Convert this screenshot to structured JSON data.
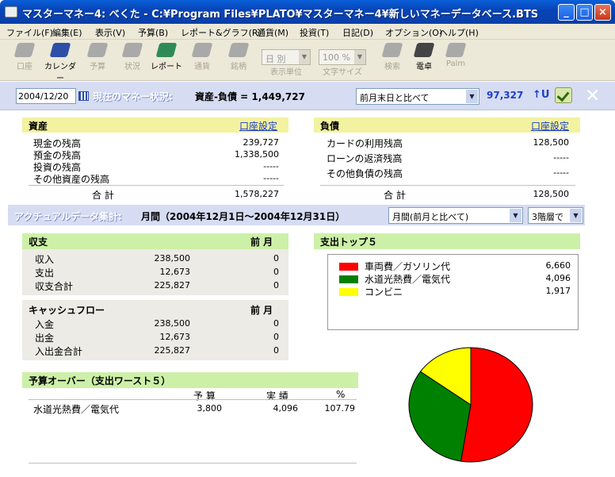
{
  "window": {
    "title": "マスターマネー4: べくた - C:¥Program Files¥PLATO¥マスターマネー4¥新しいマネーデータベース.BTS",
    "min": "_",
    "max": "□",
    "close": "×"
  },
  "menu": [
    "ファイル(F)",
    "編集(E)",
    "表示(V)",
    "予算(B)",
    "レポート&グラフ(R)",
    "通貨(M)",
    "投資(T)",
    "日記(D)",
    "オプション(O)",
    "ヘルプ(H)"
  ],
  "toolbar": {
    "koza": "口座",
    "calendar": "カレンダー",
    "budget": "予算",
    "status": "状況",
    "report": "レポート",
    "currency": "通貨",
    "brand": "銘柄",
    "unit_value": "日 別",
    "unit_label": "表示単位",
    "size_value": "100 %",
    "size_label": "文字サイズ",
    "search": "検索",
    "dentaku": "電卓",
    "palm": "Palm"
  },
  "status": {
    "date": "2004/12/20",
    "title": "現在のマネー状況:",
    "net_label": "資産-負債 =",
    "net_value": "1,449,727",
    "compare": "前月末日と比べて",
    "diff": "97,327",
    "diff_arrow": "↑U",
    "close": "✕"
  },
  "assets": {
    "title": "資産",
    "link": "口座設定",
    "rows": [
      {
        "label": "現金の残高",
        "value": "239,727"
      },
      {
        "label": "預金の残高",
        "value": "1,338,500"
      },
      {
        "label": "投資の残高",
        "value": "-----"
      },
      {
        "label": "その他資産の残高",
        "value": "-----"
      }
    ],
    "total_label": "合 計",
    "total": "1,578,227"
  },
  "liabilities": {
    "title": "負債",
    "link": "口座設定",
    "rows": [
      {
        "label": "カードの利用残高",
        "value": "128,500"
      },
      {
        "label": "ローンの返済残高",
        "value": "-----"
      },
      {
        "label": "その他負債の残高",
        "value": "-----"
      }
    ],
    "total_label": "合 計",
    "total": "128,500"
  },
  "actual": {
    "title": "アクチュアルデータ集計:",
    "period": "月間（2004年12月1日～2004年12月31日）",
    "period_select": "月間(前月と比べて)",
    "level_select": "3階層で"
  },
  "income": {
    "title": "収支",
    "col": "前 月",
    "rows": [
      {
        "label": "収入",
        "value": "238,500",
        "prev": "0"
      },
      {
        "label": "支出",
        "value": "12,673",
        "prev": "0"
      },
      {
        "label": "収支合計",
        "value": "225,827",
        "prev": "0"
      }
    ]
  },
  "cashflow": {
    "title": "キャッシュフロー",
    "col": "前 月",
    "rows": [
      {
        "label": "入金",
        "value": "238,500",
        "prev": "0"
      },
      {
        "label": "出金",
        "value": "12,673",
        "prev": "0"
      },
      {
        "label": "入出金合計",
        "value": "225,827",
        "prev": "0"
      }
    ]
  },
  "budget_over": {
    "title": "予算オーバー（支出ワースト５）",
    "cols": [
      "予 算",
      "実 績",
      "%"
    ],
    "rows": [
      {
        "label": "水道光熱費／電気代",
        "budget": "3,800",
        "actual": "4,096",
        "pct": "107.79"
      }
    ]
  },
  "top5": {
    "title": "支出トップ５",
    "items": [
      {
        "label": "車両費／ガソリン代",
        "value": "6,660",
        "color": "#ff0000"
      },
      {
        "label": "水道光熱費／電気代",
        "value": "4,096",
        "color": "#008000"
      },
      {
        "label": "コンビニ",
        "value": "1,917",
        "color": "#ffff00"
      }
    ]
  }
}
